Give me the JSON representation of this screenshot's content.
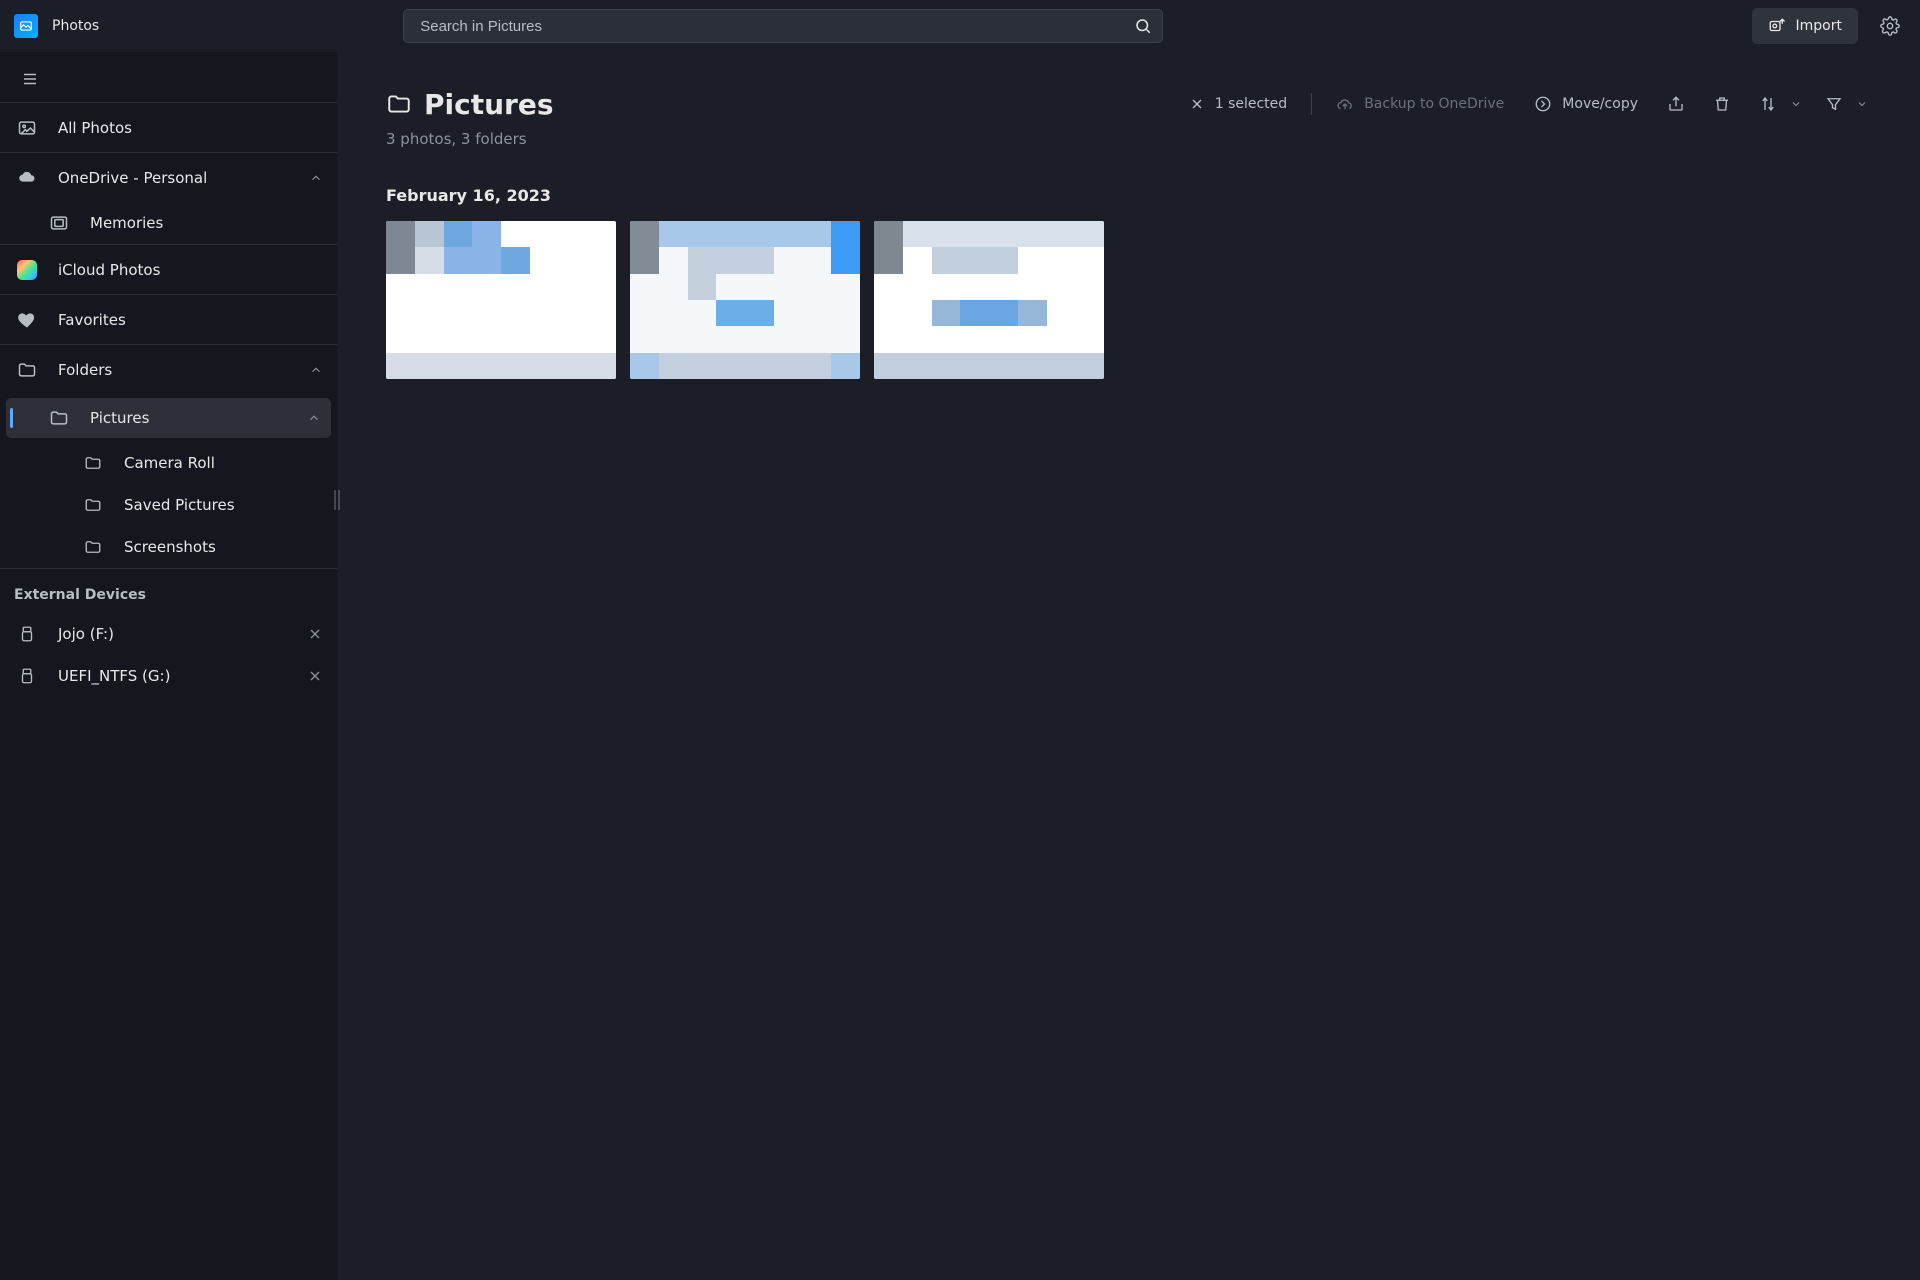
{
  "app": {
    "title": "Photos"
  },
  "search": {
    "placeholder": "Search in Pictures"
  },
  "topbar": {
    "import_label": "Import"
  },
  "sidebar": {
    "all_photos": "All Photos",
    "onedrive": "OneDrive - Personal",
    "memories": "Memories",
    "icloud": "iCloud Photos",
    "favorites": "Favorites",
    "folders": "Folders",
    "pictures": "Pictures",
    "camera_roll": "Camera Roll",
    "saved_pictures": "Saved Pictures",
    "screenshots": "Screenshots",
    "external_header": "External Devices",
    "ext1": "Jojo (F:)",
    "ext2": "UEFI_NTFS (G:)"
  },
  "page": {
    "title": "Pictures",
    "subline": "3 photos, 3 folders",
    "date_header": "February 16, 2023"
  },
  "toolbar": {
    "selected": "1 selected",
    "backup": "Backup to OneDrive",
    "movecopy": "Move/copy"
  }
}
